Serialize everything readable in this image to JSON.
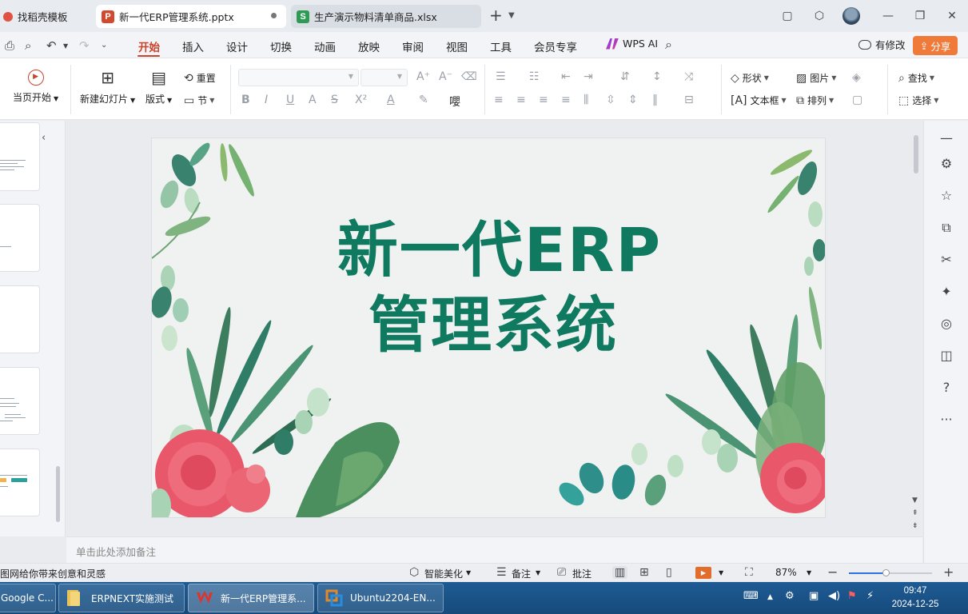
{
  "tabs": [
    {
      "label": "找稻壳模板",
      "icon": "docer-icon"
    },
    {
      "label": "新一代ERP管理系统.pptx",
      "icon": "presentation-icon",
      "logo_letter": "P",
      "color": "#d24a2e"
    },
    {
      "label": "生产演示物料清单商品.xlsx",
      "icon": "spreadsheet-icon",
      "logo_letter": "S",
      "color": "#2e9b55"
    }
  ],
  "menu": [
    "开始",
    "插入",
    "设计",
    "切换",
    "动画",
    "放映",
    "审阅",
    "视图",
    "工具",
    "会员专享"
  ],
  "active_menu": "开始",
  "wps_ai": "WPS AI",
  "modify_label": "有修改",
  "share_label": "分享",
  "ribbon": {
    "play_from_current": "当页开始",
    "new_slide": "新建幻灯片",
    "layout": "版式",
    "reset": "重置",
    "section": "节",
    "shape": "形状",
    "picture": "图片",
    "textbox": "文本框",
    "arrange": "排列",
    "find": "查找",
    "select": "选择"
  },
  "slide": {
    "title_line1": "新一代ERP",
    "title_line2": "管理系统",
    "title_color": "#0f7a60"
  },
  "notes_placeholder": "单击此处添加备注",
  "status": {
    "tip": "图网给你带来创意和灵感",
    "beautify": "智能美化",
    "notes": "备注",
    "comments": "批注",
    "zoom": "87%",
    "zoom_level": 0.87
  },
  "taskbar": [
    {
      "label": "Google C...",
      "icon": "chrome-icon"
    },
    {
      "label": "ERPNEXT实施测试",
      "icon": "folder-icon"
    },
    {
      "label": "新一代ERP管理系...",
      "icon": "wps-icon"
    },
    {
      "label": "Ubuntu2204-EN...",
      "icon": "vm-icon"
    }
  ],
  "clock": {
    "time": "09:47",
    "date": "2024-12-25"
  }
}
